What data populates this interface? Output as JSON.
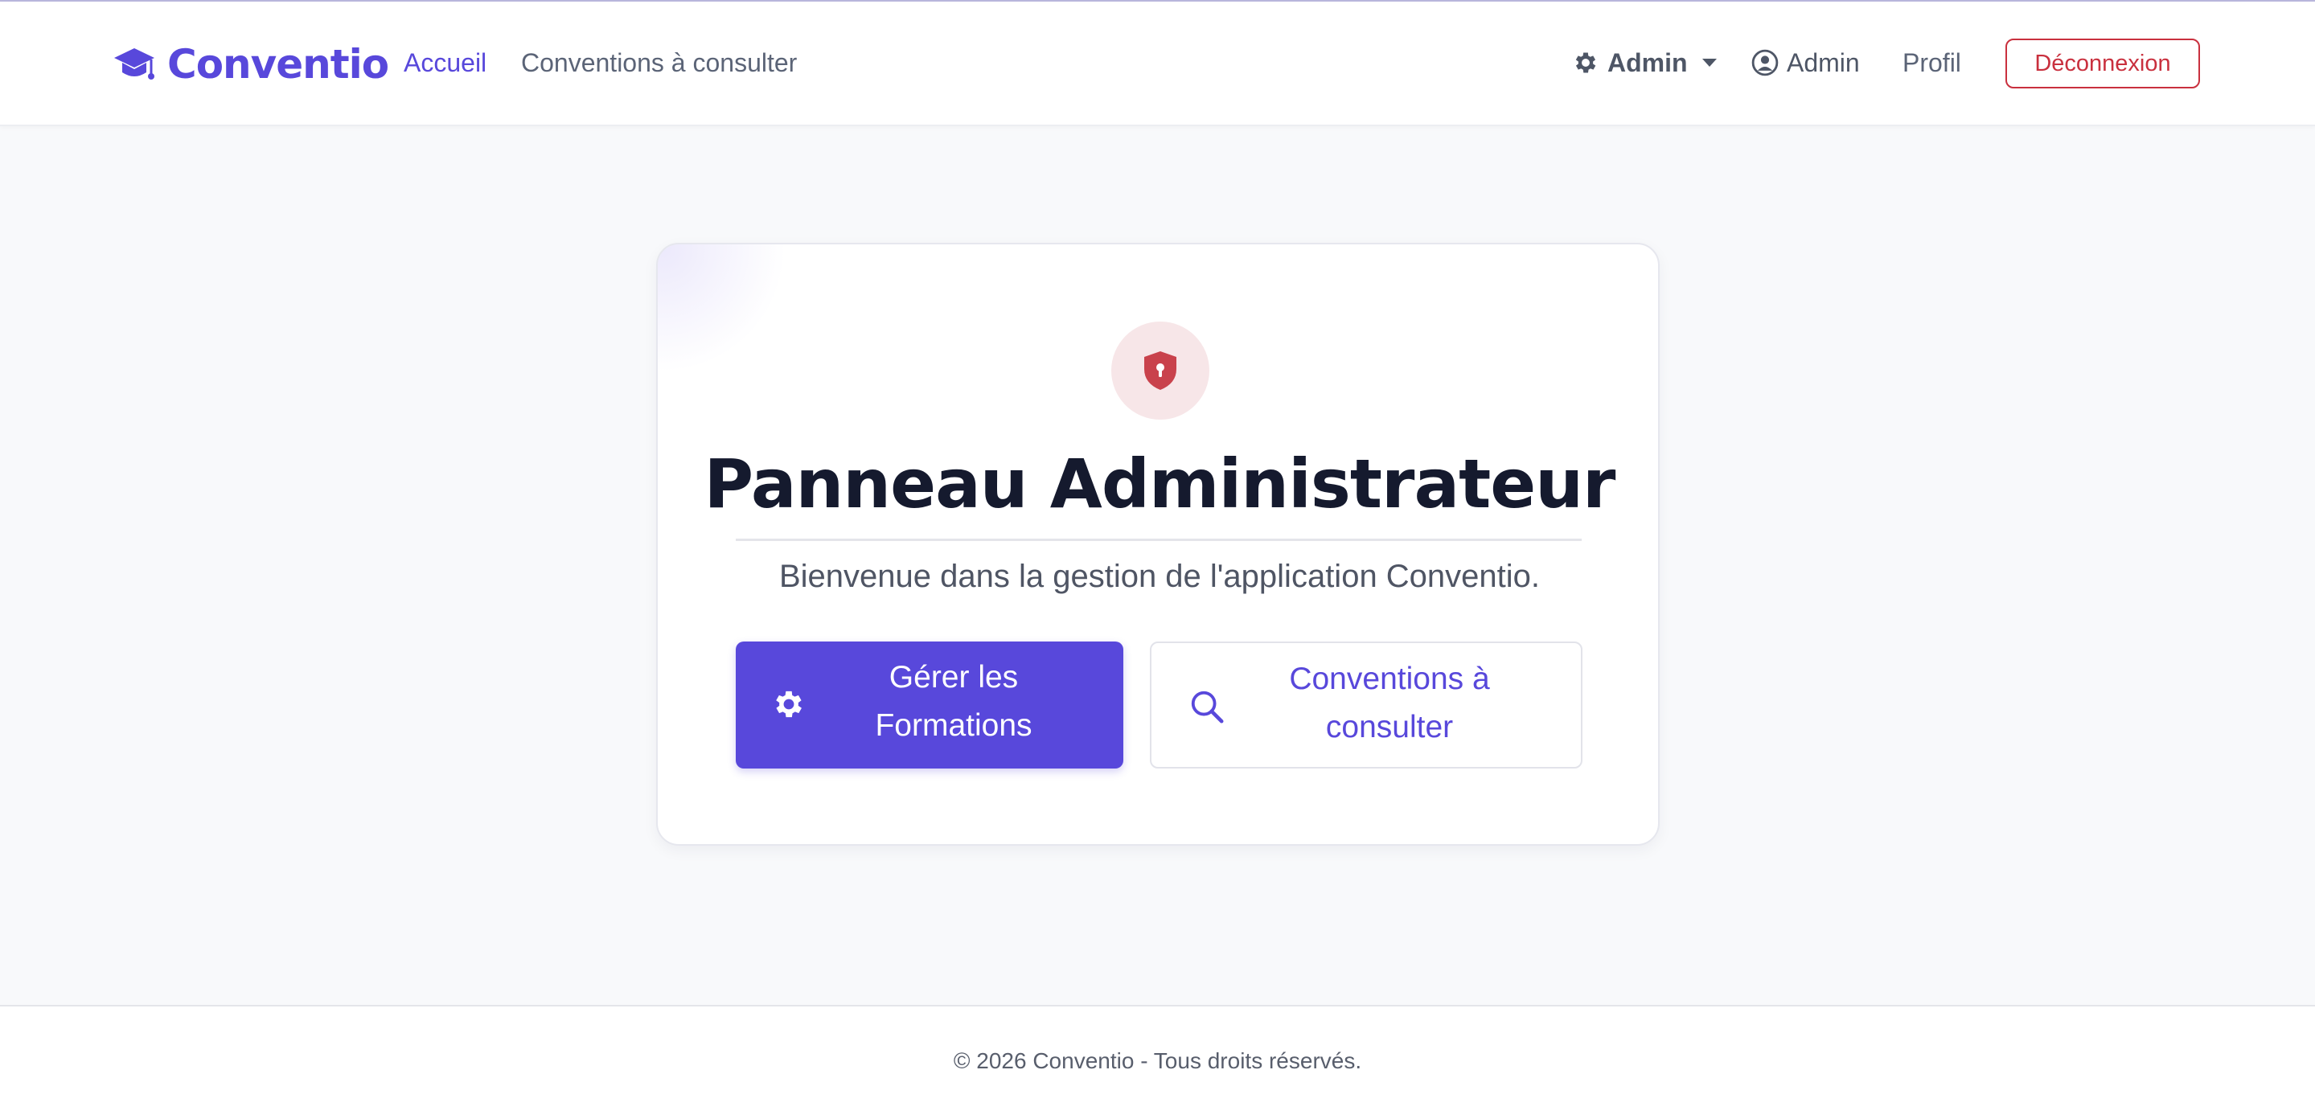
{
  "navbar": {
    "brand": "Conventio",
    "links": [
      "Accueil",
      "Conventions à consulter"
    ],
    "admin_menu": "Admin",
    "user_name": "Admin",
    "profile": "Profil",
    "logout": "Déconnexion"
  },
  "card": {
    "title": "Panneau Administrateur",
    "subtitle": "Bienvenue dans la gestion de l'application Conventio.",
    "primary_button": "Gérer les Formations",
    "secondary_button": "Conventions à consulter"
  },
  "footer": {
    "text": "© 2026 Conventio - Tous droits réservés."
  },
  "icons": {
    "brand": "graduation-cap-icon",
    "admin": "gear-icon",
    "user": "user-circle-icon",
    "card": "shield-lock-icon",
    "primary": "gear-icon",
    "secondary": "search-icon"
  },
  "colors": {
    "accent": "#5848db",
    "danger": "#c9303e",
    "title": "#151a2e",
    "background": "#f8f9fb"
  }
}
